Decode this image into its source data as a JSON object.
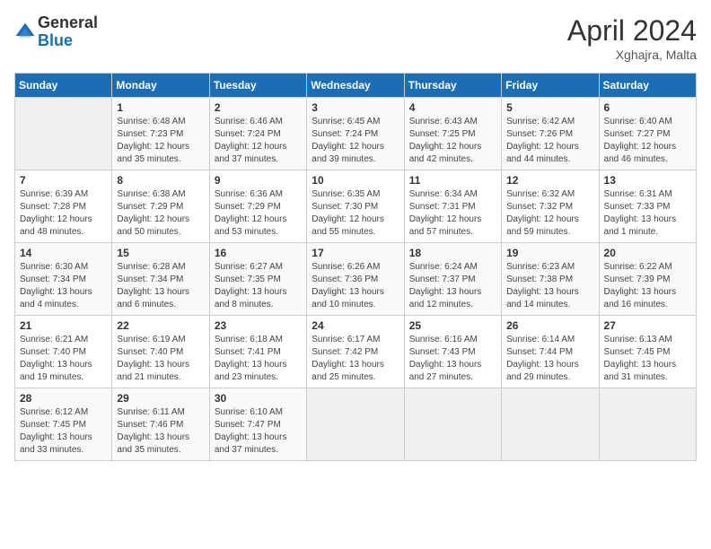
{
  "header": {
    "logo_general": "General",
    "logo_blue": "Blue",
    "month_year": "April 2024",
    "location": "Xghajra, Malta"
  },
  "weekdays": [
    "Sunday",
    "Monday",
    "Tuesday",
    "Wednesday",
    "Thursday",
    "Friday",
    "Saturday"
  ],
  "weeks": [
    [
      {
        "day": "",
        "sunrise": "",
        "sunset": "",
        "daylight": ""
      },
      {
        "day": "1",
        "sunrise": "Sunrise: 6:48 AM",
        "sunset": "Sunset: 7:23 PM",
        "daylight": "Daylight: 12 hours and 35 minutes."
      },
      {
        "day": "2",
        "sunrise": "Sunrise: 6:46 AM",
        "sunset": "Sunset: 7:24 PM",
        "daylight": "Daylight: 12 hours and 37 minutes."
      },
      {
        "day": "3",
        "sunrise": "Sunrise: 6:45 AM",
        "sunset": "Sunset: 7:24 PM",
        "daylight": "Daylight: 12 hours and 39 minutes."
      },
      {
        "day": "4",
        "sunrise": "Sunrise: 6:43 AM",
        "sunset": "Sunset: 7:25 PM",
        "daylight": "Daylight: 12 hours and 42 minutes."
      },
      {
        "day": "5",
        "sunrise": "Sunrise: 6:42 AM",
        "sunset": "Sunset: 7:26 PM",
        "daylight": "Daylight: 12 hours and 44 minutes."
      },
      {
        "day": "6",
        "sunrise": "Sunrise: 6:40 AM",
        "sunset": "Sunset: 7:27 PM",
        "daylight": "Daylight: 12 hours and 46 minutes."
      }
    ],
    [
      {
        "day": "7",
        "sunrise": "Sunrise: 6:39 AM",
        "sunset": "Sunset: 7:28 PM",
        "daylight": "Daylight: 12 hours and 48 minutes."
      },
      {
        "day": "8",
        "sunrise": "Sunrise: 6:38 AM",
        "sunset": "Sunset: 7:29 PM",
        "daylight": "Daylight: 12 hours and 50 minutes."
      },
      {
        "day": "9",
        "sunrise": "Sunrise: 6:36 AM",
        "sunset": "Sunset: 7:29 PM",
        "daylight": "Daylight: 12 hours and 53 minutes."
      },
      {
        "day": "10",
        "sunrise": "Sunrise: 6:35 AM",
        "sunset": "Sunset: 7:30 PM",
        "daylight": "Daylight: 12 hours and 55 minutes."
      },
      {
        "day": "11",
        "sunrise": "Sunrise: 6:34 AM",
        "sunset": "Sunset: 7:31 PM",
        "daylight": "Daylight: 12 hours and 57 minutes."
      },
      {
        "day": "12",
        "sunrise": "Sunrise: 6:32 AM",
        "sunset": "Sunset: 7:32 PM",
        "daylight": "Daylight: 12 hours and 59 minutes."
      },
      {
        "day": "13",
        "sunrise": "Sunrise: 6:31 AM",
        "sunset": "Sunset: 7:33 PM",
        "daylight": "Daylight: 13 hours and 1 minute."
      }
    ],
    [
      {
        "day": "14",
        "sunrise": "Sunrise: 6:30 AM",
        "sunset": "Sunset: 7:34 PM",
        "daylight": "Daylight: 13 hours and 4 minutes."
      },
      {
        "day": "15",
        "sunrise": "Sunrise: 6:28 AM",
        "sunset": "Sunset: 7:34 PM",
        "daylight": "Daylight: 13 hours and 6 minutes."
      },
      {
        "day": "16",
        "sunrise": "Sunrise: 6:27 AM",
        "sunset": "Sunset: 7:35 PM",
        "daylight": "Daylight: 13 hours and 8 minutes."
      },
      {
        "day": "17",
        "sunrise": "Sunrise: 6:26 AM",
        "sunset": "Sunset: 7:36 PM",
        "daylight": "Daylight: 13 hours and 10 minutes."
      },
      {
        "day": "18",
        "sunrise": "Sunrise: 6:24 AM",
        "sunset": "Sunset: 7:37 PM",
        "daylight": "Daylight: 13 hours and 12 minutes."
      },
      {
        "day": "19",
        "sunrise": "Sunrise: 6:23 AM",
        "sunset": "Sunset: 7:38 PM",
        "daylight": "Daylight: 13 hours and 14 minutes."
      },
      {
        "day": "20",
        "sunrise": "Sunrise: 6:22 AM",
        "sunset": "Sunset: 7:39 PM",
        "daylight": "Daylight: 13 hours and 16 minutes."
      }
    ],
    [
      {
        "day": "21",
        "sunrise": "Sunrise: 6:21 AM",
        "sunset": "Sunset: 7:40 PM",
        "daylight": "Daylight: 13 hours and 19 minutes."
      },
      {
        "day": "22",
        "sunrise": "Sunrise: 6:19 AM",
        "sunset": "Sunset: 7:40 PM",
        "daylight": "Daylight: 13 hours and 21 minutes."
      },
      {
        "day": "23",
        "sunrise": "Sunrise: 6:18 AM",
        "sunset": "Sunset: 7:41 PM",
        "daylight": "Daylight: 13 hours and 23 minutes."
      },
      {
        "day": "24",
        "sunrise": "Sunrise: 6:17 AM",
        "sunset": "Sunset: 7:42 PM",
        "daylight": "Daylight: 13 hours and 25 minutes."
      },
      {
        "day": "25",
        "sunrise": "Sunrise: 6:16 AM",
        "sunset": "Sunset: 7:43 PM",
        "daylight": "Daylight: 13 hours and 27 minutes."
      },
      {
        "day": "26",
        "sunrise": "Sunrise: 6:14 AM",
        "sunset": "Sunset: 7:44 PM",
        "daylight": "Daylight: 13 hours and 29 minutes."
      },
      {
        "day": "27",
        "sunrise": "Sunrise: 6:13 AM",
        "sunset": "Sunset: 7:45 PM",
        "daylight": "Daylight: 13 hours and 31 minutes."
      }
    ],
    [
      {
        "day": "28",
        "sunrise": "Sunrise: 6:12 AM",
        "sunset": "Sunset: 7:45 PM",
        "daylight": "Daylight: 13 hours and 33 minutes."
      },
      {
        "day": "29",
        "sunrise": "Sunrise: 6:11 AM",
        "sunset": "Sunset: 7:46 PM",
        "daylight": "Daylight: 13 hours and 35 minutes."
      },
      {
        "day": "30",
        "sunrise": "Sunrise: 6:10 AM",
        "sunset": "Sunset: 7:47 PM",
        "daylight": "Daylight: 13 hours and 37 minutes."
      },
      {
        "day": "",
        "sunrise": "",
        "sunset": "",
        "daylight": ""
      },
      {
        "day": "",
        "sunrise": "",
        "sunset": "",
        "daylight": ""
      },
      {
        "day": "",
        "sunrise": "",
        "sunset": "",
        "daylight": ""
      },
      {
        "day": "",
        "sunrise": "",
        "sunset": "",
        "daylight": ""
      }
    ]
  ]
}
